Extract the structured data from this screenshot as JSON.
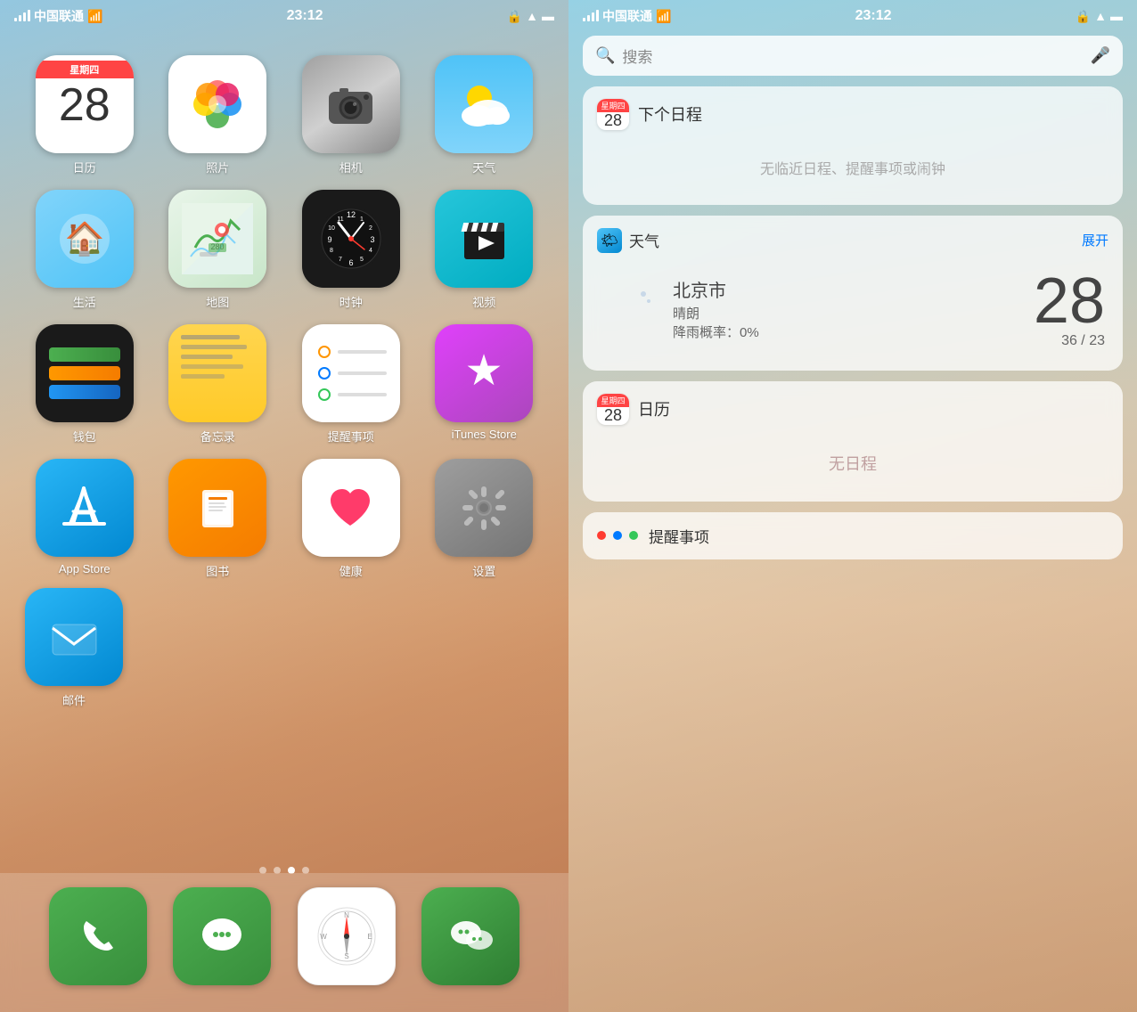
{
  "left": {
    "statusBar": {
      "carrier": "中国联通",
      "time": "23:12",
      "wifi": true,
      "battery": "100%"
    },
    "apps": [
      {
        "id": "calendar",
        "label": "日历",
        "icon": "calendar",
        "date": "28",
        "weekday": "星期四"
      },
      {
        "id": "photos",
        "label": "照片",
        "icon": "photos"
      },
      {
        "id": "camera",
        "label": "相机",
        "icon": "camera"
      },
      {
        "id": "weather",
        "label": "天气",
        "icon": "weather"
      },
      {
        "id": "life",
        "label": "生活",
        "icon": "life"
      },
      {
        "id": "maps",
        "label": "地图",
        "icon": "maps"
      },
      {
        "id": "clock",
        "label": "时钟",
        "icon": "clock"
      },
      {
        "id": "videos",
        "label": "视频",
        "icon": "videos"
      },
      {
        "id": "wallet",
        "label": "钱包",
        "icon": "wallet"
      },
      {
        "id": "notes",
        "label": "备忘录",
        "icon": "notes"
      },
      {
        "id": "reminders",
        "label": "提醒事项",
        "icon": "reminders"
      },
      {
        "id": "itunes",
        "label": "iTunes Store",
        "icon": "itunes"
      },
      {
        "id": "appstore",
        "label": "App Store",
        "icon": "appstore"
      },
      {
        "id": "books",
        "label": "图书",
        "icon": "books"
      },
      {
        "id": "health",
        "label": "健康",
        "icon": "health"
      },
      {
        "id": "settings",
        "label": "设置",
        "icon": "settings"
      }
    ],
    "mailLabel": "邮件",
    "dock": [
      {
        "id": "phone",
        "label": "电话",
        "icon": "phone"
      },
      {
        "id": "messages",
        "label": "信息",
        "icon": "messages"
      },
      {
        "id": "safari",
        "label": "Safari",
        "icon": "safari"
      },
      {
        "id": "wechat",
        "label": "微信",
        "icon": "wechat"
      }
    ],
    "pageDots": [
      false,
      false,
      true,
      false
    ]
  },
  "right": {
    "statusBar": {
      "carrier": "中国联通",
      "time": "23:12"
    },
    "search": {
      "placeholder": "搜索"
    },
    "widgets": {
      "nextSchedule": {
        "title": "下个日程",
        "empty": "无临近日程、提醒事项或闹钟",
        "date": "28",
        "weekday": "星期四"
      },
      "weather": {
        "title": "天气",
        "expand": "展开",
        "city": "北京市",
        "condition": "晴朗",
        "rainChance": "降雨概率：0%",
        "temp": "28",
        "tempRange": "36 / 23"
      },
      "calendar": {
        "title": "日历",
        "empty": "无日程",
        "date": "28",
        "weekday": "星期四"
      },
      "reminders": {
        "title": "提醒事项"
      }
    }
  }
}
